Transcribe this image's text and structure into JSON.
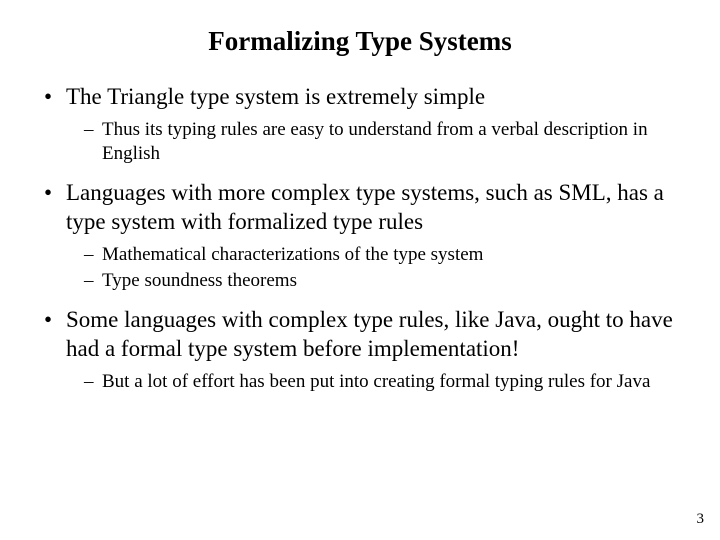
{
  "title": "Formalizing Type Systems",
  "bullets": [
    {
      "text": "The Triangle type system is extremely simple",
      "sub": [
        "Thus its typing rules are easy to understand from a verbal description in English"
      ]
    },
    {
      "text": "Languages with more complex type systems, such as SML, has a type system with formalized type rules",
      "sub": [
        "Mathematical characterizations of the type system",
        "Type soundness theorems"
      ]
    },
    {
      "text": "Some languages with complex type rules, like Java, ought to have had a formal type system before implementation!",
      "sub": [
        "But a lot of effort has been put into creating formal typing rules for Java"
      ]
    }
  ],
  "page_number": "3"
}
